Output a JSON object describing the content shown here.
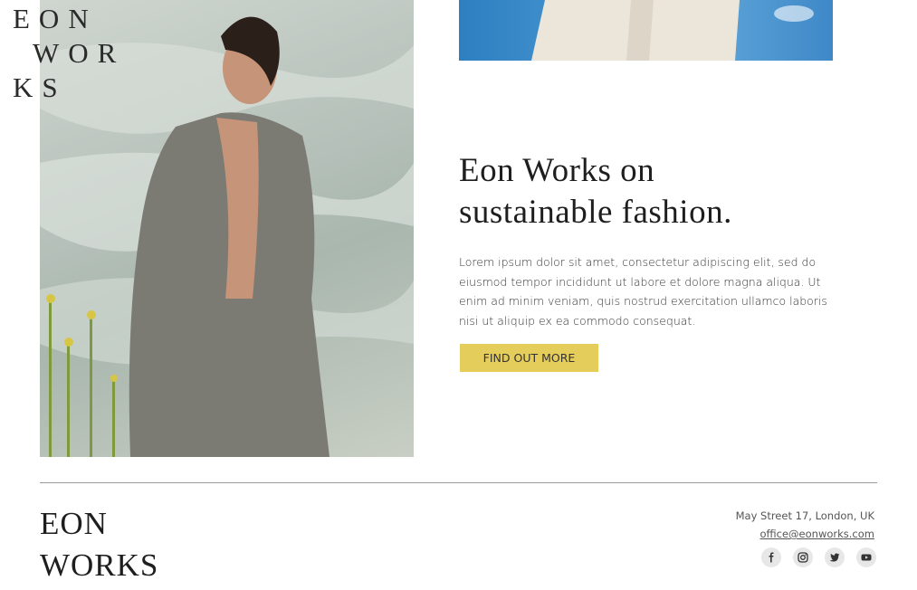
{
  "brand": {
    "logo_line1": "EON",
    "logo_line2": "WOR",
    "logo_line3": "KS"
  },
  "feature": {
    "headline_line1": "Eon Works on",
    "headline_line2": "sustainable fashion.",
    "body": "Lorem ipsum dolor sit amet, consectetur adipiscing elit, sed do eiusmod tempor incididunt ut labore et dolore magna aliqua. Ut enim ad minim veniam, quis nostrud exercitation ullamco laboris nisi ut aliquip ex ea commodo consequat.",
    "cta_label": "FIND OUT MORE"
  },
  "footer": {
    "logo_line1": "EON",
    "logo_line2": "WORKS",
    "address": "May Street 17, London, UK",
    "email": "office@eonworks.com",
    "social": [
      "facebook-icon",
      "instagram-icon",
      "twitter-icon",
      "youtube-icon"
    ]
  },
  "colors": {
    "accent": "#e5cd5c",
    "text": "#1e1e1e",
    "icon_bg": "#e7e7e7"
  }
}
